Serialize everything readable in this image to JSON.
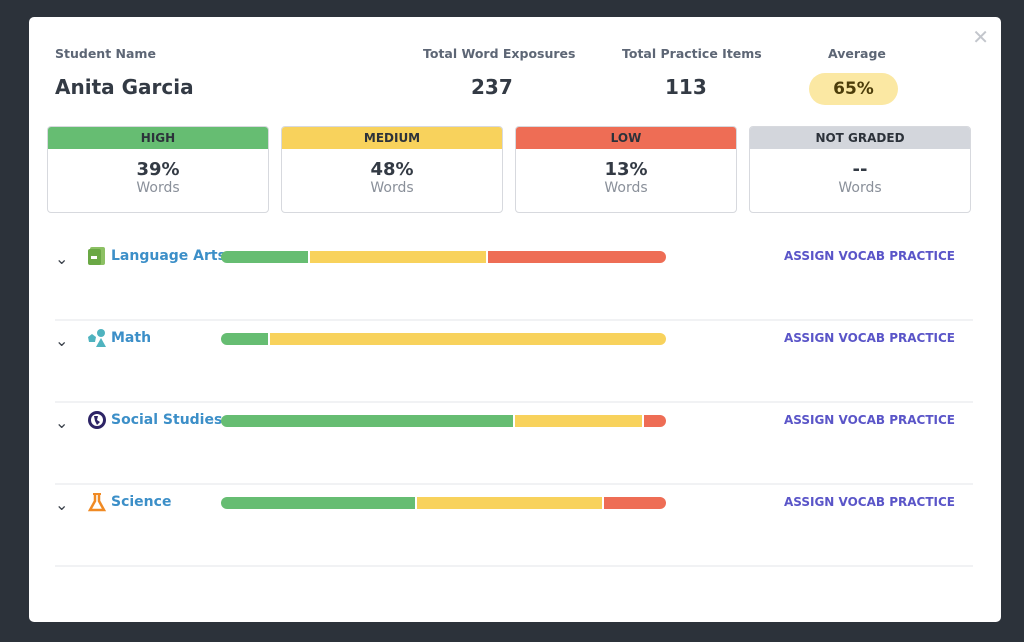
{
  "colors": {
    "high": "#66bd72",
    "medium": "#f8d25c",
    "low": "#ee6d55",
    "not_graded": "#d3d6dc"
  },
  "header": {
    "student_label": "Student Name",
    "student_name": "Anita Garcia",
    "exposures_label": "Total Word Exposures",
    "exposures": "237",
    "practice_label": "Total Practice Items",
    "practice": "113",
    "average_label": "Average",
    "average": "65%"
  },
  "cards": [
    {
      "title": "HIGH",
      "pct": "39%",
      "unit": "Words",
      "color": "#66bd72"
    },
    {
      "title": "MEDIUM",
      "pct": "48%",
      "unit": "Words",
      "color": "#f8d25c"
    },
    {
      "title": "LOW",
      "pct": "13%",
      "unit": "Words",
      "color": "#ee6d55"
    },
    {
      "title": "NOT GRADED",
      "pct": "--",
      "unit": "Words",
      "color": "#d3d6dc"
    }
  ],
  "subjects": [
    {
      "name": "Language Arts",
      "icon": "book-icon",
      "high": 20,
      "medium": 40,
      "low": 40,
      "action": "ASSIGN VOCAB PRACTICE"
    },
    {
      "name": "Math",
      "icon": "shapes-icon",
      "high": 11,
      "medium": 89,
      "low": 0,
      "action": "ASSIGN VOCAB PRACTICE"
    },
    {
      "name": "Social Studies",
      "icon": "globe-icon",
      "high": 66,
      "medium": 29,
      "low": 5,
      "action": "ASSIGN VOCAB PRACTICE"
    },
    {
      "name": "Science",
      "icon": "flask-icon",
      "high": 44,
      "medium": 42,
      "low": 14,
      "action": "ASSIGN VOCAB PRACTICE"
    }
  ]
}
